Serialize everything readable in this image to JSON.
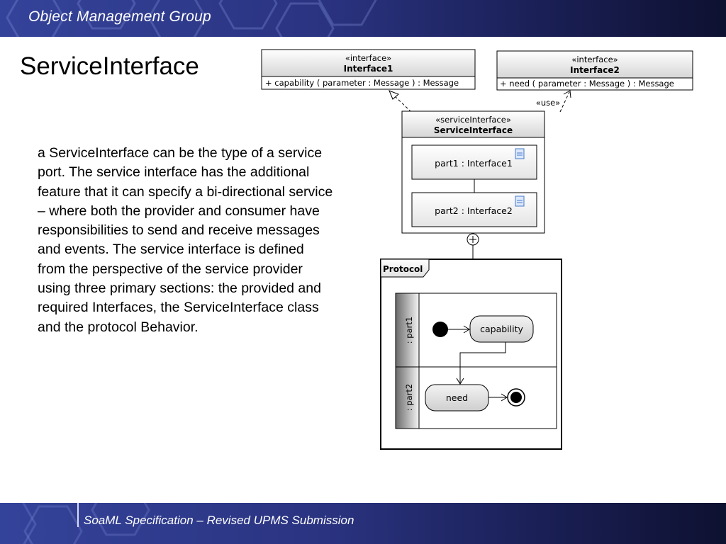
{
  "header": {
    "org_name": "Object Management Group"
  },
  "title": "ServiceInterface",
  "body_text": "a ServiceInterface can be the type of a service port.  The service interface has the additional feature that it can specify a bi-directional service – where both the provider and consumer have responsibilities to send and receive messages and events.  The service interface is defined from the perspective of the service provider using three primary sections: the provided and required Interfaces, the ServiceInterface class and the protocol Behavior.",
  "diagram": {
    "interface1": {
      "stereotype": "«interface»",
      "name": "Interface1",
      "operation": "+ capability ( parameter : Message ) : Message"
    },
    "interface2": {
      "stereotype": "«interface»",
      "name": "Interface2",
      "operation": "+ need ( parameter : Message ) : Message"
    },
    "use_label": "«use»",
    "service_interface": {
      "stereotype": "«serviceInterface»",
      "name": "ServiceInterface",
      "parts": [
        "part1 : Interface1",
        "part2 : Interface2"
      ]
    },
    "protocol": {
      "title": "Protocol",
      "lanes": [
        ": part1",
        ": part2"
      ],
      "actions": [
        "capability",
        "need"
      ]
    }
  },
  "footer": {
    "text": "SoaML Specification – Revised UPMS Submission"
  },
  "colors": {
    "banner_start": "#34439a",
    "banner_end": "#0e1130",
    "class_header": "#dcdcdc"
  }
}
